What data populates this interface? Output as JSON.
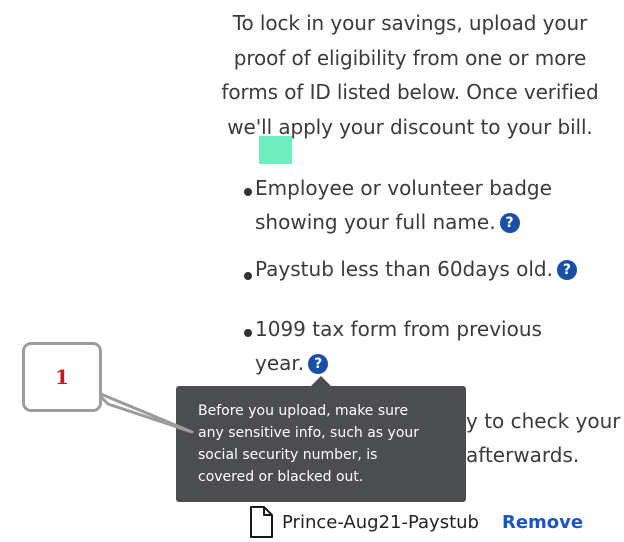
{
  "intro": {
    "lines": [
      "To lock in your savings, upload your",
      "proof of eligibility from one or more",
      "forms of ID listed below.  Once verified",
      "we'll apply your discount to your bill."
    ]
  },
  "marker_color": "#6eeec0",
  "eligibility_list": {
    "items": [
      {
        "lines": [
          "Employee or volunteer badge",
          "showing your full name."
        ]
      },
      {
        "lines": [
          "Paystub less than 60days old."
        ]
      },
      {
        "lines": [
          "1099 tax form from previous",
          "year."
        ]
      }
    ],
    "help_glyph": "?"
  },
  "background_text": {
    "line1_fragment": "y to check your",
    "line2_fragment": "afterwards."
  },
  "tooltip": {
    "lines": [
      "Before you upload, make sure",
      "any sensitive info, such as your",
      "social security number, is",
      "covered or blacked out."
    ]
  },
  "callout": {
    "number": "1",
    "number_color": "#d01414"
  },
  "upload": {
    "file_name": "Prince-Aug21-Paystub",
    "file_icon": "document-icon",
    "remove_label": "Remove",
    "link_color": "#1b55c2"
  }
}
